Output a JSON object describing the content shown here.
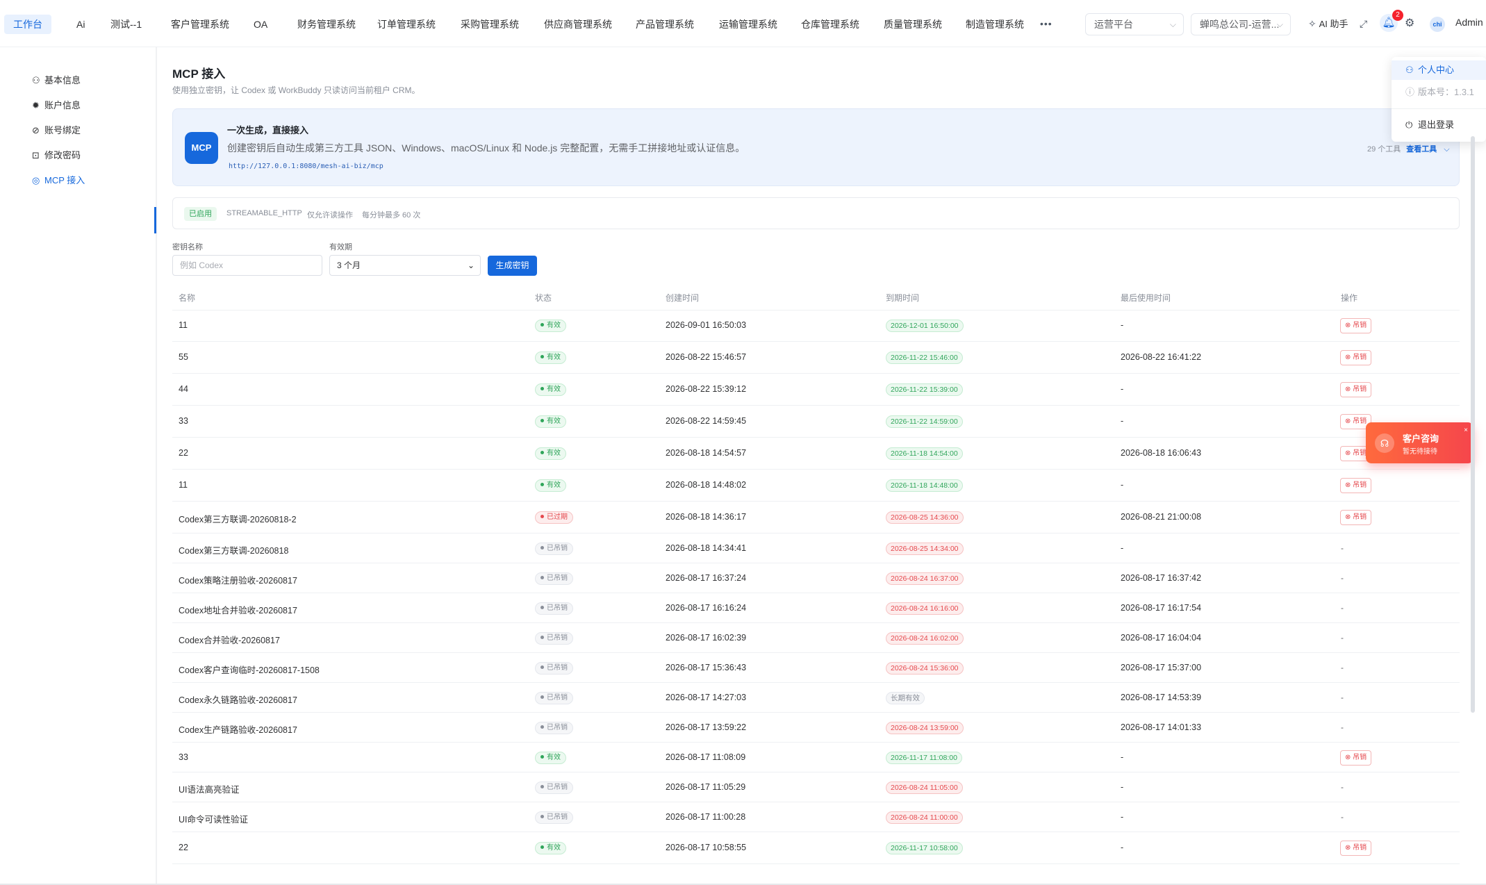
{
  "nav": {
    "tabs": [
      "工作台",
      "Ai",
      "测试--1",
      "客户管理系统",
      "OA",
      "财务管理系统",
      "订单管理系统",
      "采购管理系统",
      "供应商管理系统",
      "产品管理系统",
      "运输管理系统",
      "仓库管理系统",
      "质量管理系统",
      "制造管理系统"
    ],
    "more": "•••",
    "platform_select": "运营平台",
    "company_select": "蝉鸣总公司-运营...",
    "ai_assistant": "AI 助手",
    "notification_count": "2",
    "avatar_text": "chi",
    "user": "Admin"
  },
  "sidebar": {
    "items": [
      {
        "label": "基本信息",
        "icon": "user-icon"
      },
      {
        "label": "账户信息",
        "icon": "gear-icon"
      },
      {
        "label": "账号绑定",
        "icon": "link-icon"
      },
      {
        "label": "修改密码",
        "icon": "lock-icon"
      },
      {
        "label": "MCP 接入",
        "icon": "mcp-icon"
      }
    ]
  },
  "page": {
    "title": "MCP 接入",
    "description": "使用独立密钥，让 Codex 或 WorkBuddy 只读访问当前租户 CRM。"
  },
  "hero": {
    "logo": "MCP",
    "title": "一次生成，直接接入",
    "description": "创建密钥后自动生成第三方工具 JSON、Windows、macOS/Linux 和 Node.js 完整配置，无需手工拼接地址或认证信息。",
    "url": "http://127.0.0.1:8080/mesh-ai-biz/mcp",
    "tools_count": "29 个工具",
    "view_tools": "查看工具"
  },
  "status": {
    "enabled": "已启用",
    "transport": "STREAMABLE_HTTP",
    "mode": "仅允许读操作",
    "rate": "每分钟最多 60 次"
  },
  "form": {
    "name_label": "密钥名称",
    "name_placeholder": "例如 Codex",
    "period_label": "有效期",
    "period_value": "3 个月",
    "submit": "生成密钥"
  },
  "table": {
    "headers": [
      "名称",
      "状态",
      "创建时间",
      "到期时间",
      "最后使用时间",
      "操作"
    ],
    "revoke_label": "吊销",
    "rows": [
      {
        "name": "11",
        "status": "有效",
        "created": "2026-09-01 16:50:03",
        "expires": "2026-12-01 16:50:00",
        "last_used": "-",
        "action": "吊销"
      },
      {
        "name": "55",
        "status": "有效",
        "created": "2026-08-22 15:46:57",
        "expires": "2026-11-22 15:46:00",
        "last_used": "2026-08-22 16:41:22",
        "action": "吊销"
      },
      {
        "name": "44",
        "status": "有效",
        "created": "2026-08-22 15:39:12",
        "expires": "2026-11-22 15:39:00",
        "last_used": "-",
        "action": "吊销"
      },
      {
        "name": "33",
        "status": "有效",
        "created": "2026-08-22 14:59:45",
        "expires": "2026-11-22 14:59:00",
        "last_used": "-",
        "action": "吊销"
      },
      {
        "name": "22",
        "status": "有效",
        "created": "2026-08-18 14:54:57",
        "expires": "2026-11-18 14:54:00",
        "last_used": "2026-08-18 16:06:43",
        "action": "吊销"
      },
      {
        "name": "11",
        "status": "有效",
        "created": "2026-08-18 14:48:02",
        "expires": "2026-11-18 14:48:00",
        "last_used": "-",
        "action": "吊销"
      },
      {
        "name": "Codex第三方联调-20260818-2",
        "status": "已过期",
        "created": "2026-08-18 14:36:17",
        "expires": "2026-08-25 14:36:00",
        "last_used": "2026-08-21 21:00:08",
        "action": "吊销"
      },
      {
        "name": "Codex第三方联调-20260818",
        "status": "已吊销",
        "created": "2026-08-18 14:34:41",
        "expires": "2026-08-25 14:34:00",
        "last_used": "-",
        "action": "-"
      },
      {
        "name": "Codex策略注册验收-20260817",
        "status": "已吊销",
        "created": "2026-08-17 16:37:24",
        "expires": "2026-08-24 16:37:00",
        "last_used": "2026-08-17 16:37:42",
        "action": "-"
      },
      {
        "name": "Codex地址合并验收-20260817",
        "status": "已吊销",
        "created": "2026-08-17 16:16:24",
        "expires": "2026-08-24 16:16:00",
        "last_used": "2026-08-17 16:17:54",
        "action": "-"
      },
      {
        "name": "Codex合并验收-20260817",
        "status": "已吊销",
        "created": "2026-08-17 16:02:39",
        "expires": "2026-08-24 16:02:00",
        "last_used": "2026-08-17 16:04:04",
        "action": "-"
      },
      {
        "name": "Codex客户查询临时-20260817-1508",
        "status": "已吊销",
        "created": "2026-08-17 15:36:43",
        "expires": "2026-08-24 15:36:00",
        "last_used": "2026-08-17 15:37:00",
        "action": "-"
      },
      {
        "name": "Codex永久链路验收-20260817",
        "status": "已吊销",
        "created": "2026-08-17 14:27:03",
        "expires": "长期有效",
        "last_used": "2026-08-17 14:53:39",
        "action": "-"
      },
      {
        "name": "Codex生产链路验收-20260817",
        "status": "已吊销",
        "created": "2026-08-17 13:59:22",
        "expires": "2026-08-24 13:59:00",
        "last_used": "2026-08-17 14:01:33",
        "action": "-"
      },
      {
        "name": "33",
        "status": "有效",
        "created": "2026-08-17 11:08:09",
        "expires": "2026-11-17 11:08:00",
        "last_used": "-",
        "action": "吊销"
      },
      {
        "name": "UI语法高亮验证",
        "status": "已吊销",
        "created": "2026-08-17 11:05:29",
        "expires": "2026-08-24 11:05:00",
        "last_used": "-",
        "action": "-"
      },
      {
        "name": "UI命令可读性验证",
        "status": "已吊销",
        "created": "2026-08-17 11:00:28",
        "expires": "2026-08-24 11:00:00",
        "last_used": "-",
        "action": "-"
      },
      {
        "name": "22",
        "status": "有效",
        "created": "2026-08-17 10:58:55",
        "expires": "2026-11-17 10:58:00",
        "last_used": "-",
        "action": "吊销"
      }
    ]
  },
  "user_menu": {
    "items": [
      "个人中心",
      "版本号：1.3.1",
      "退出登录"
    ]
  },
  "consult": {
    "title": "客户咨询",
    "subtitle": "暂无待接待",
    "close": "×"
  },
  "colors": {
    "primary": "#1668dc",
    "success": "#2fa55a",
    "danger": "#e5484d",
    "muted": "#8a8f99"
  }
}
